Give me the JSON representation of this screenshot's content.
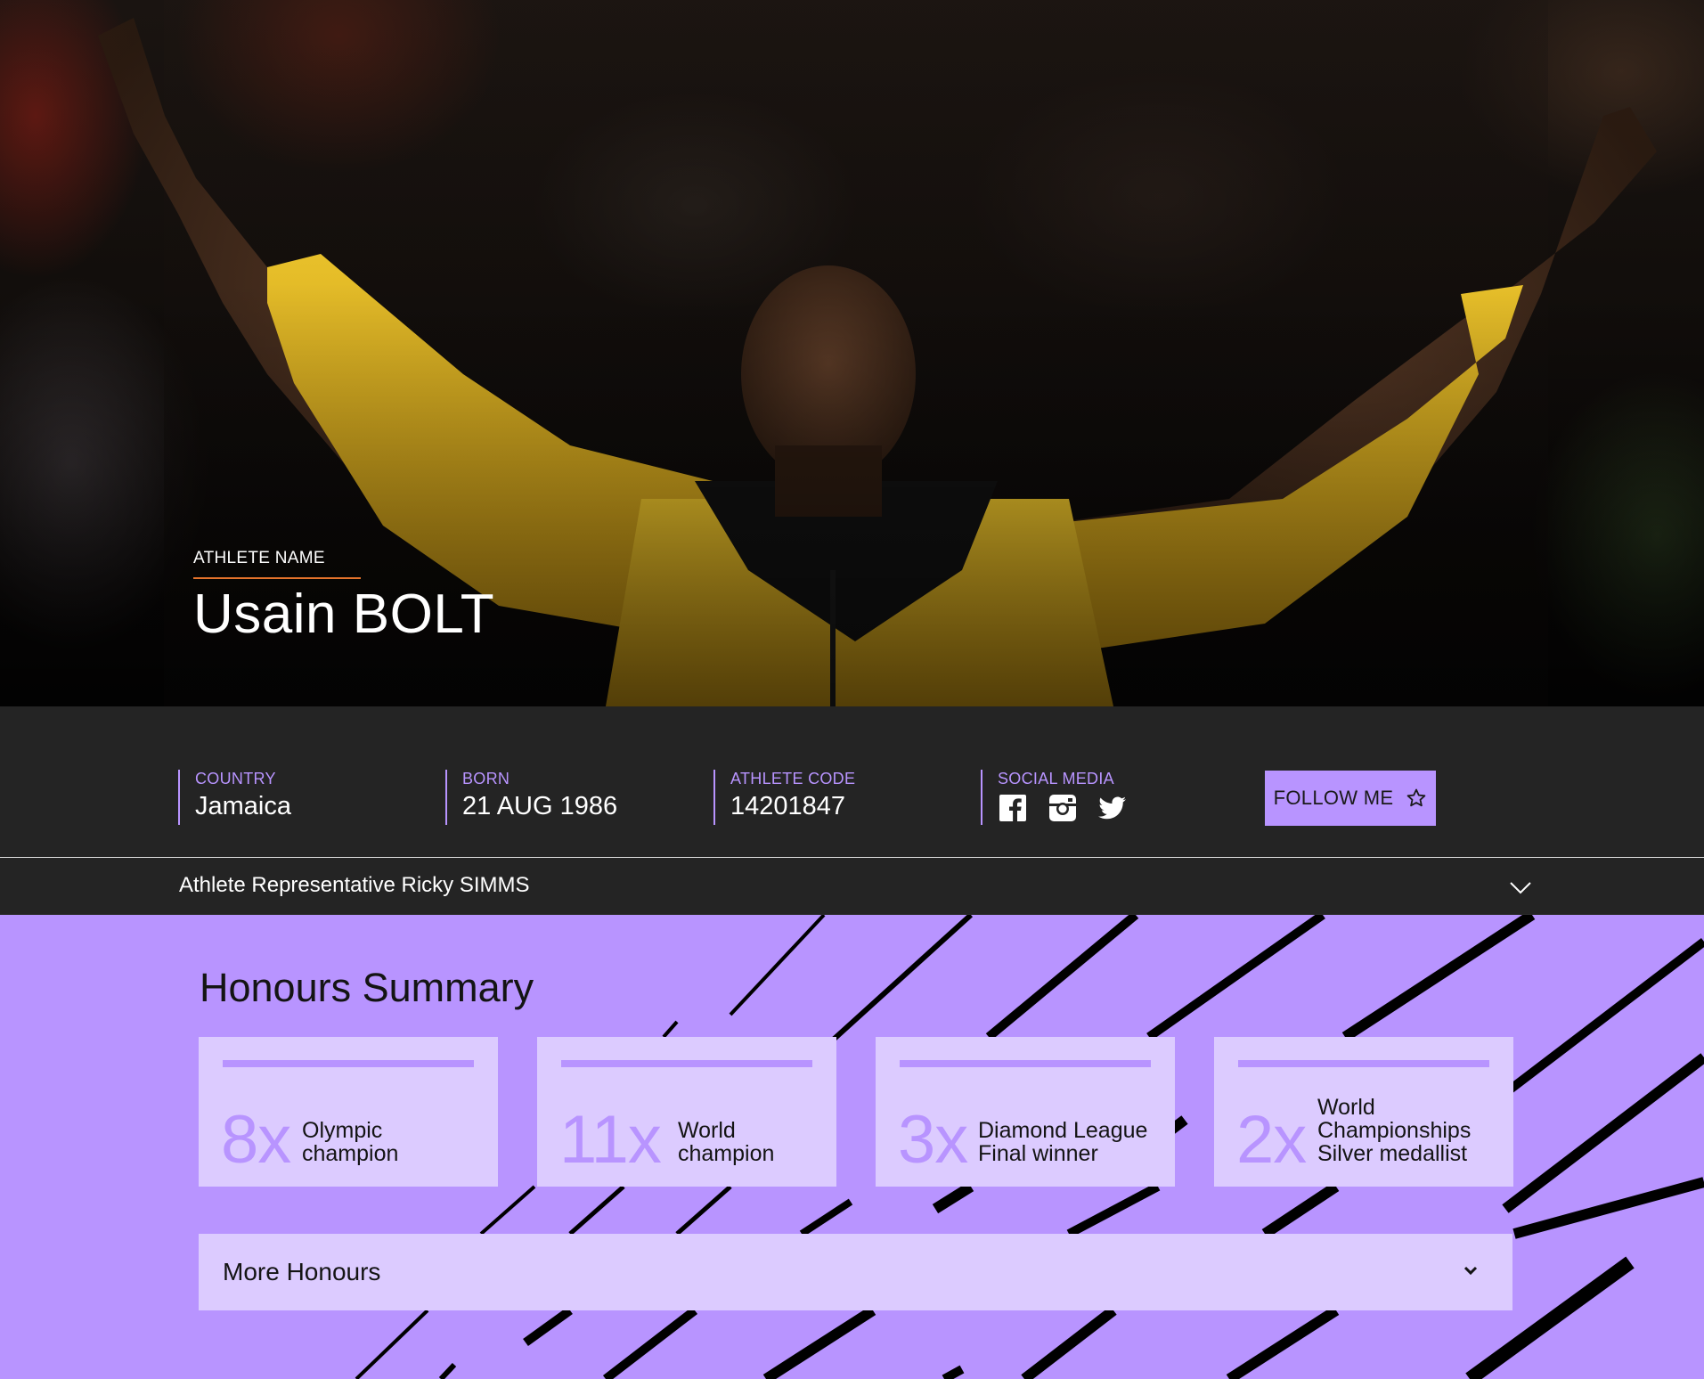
{
  "hero": {
    "label": "ATHLETE NAME",
    "name": "Usain BOLT"
  },
  "info": {
    "country_label": "COUNTRY",
    "country_value": "Jamaica",
    "born_label": "BORN",
    "born_value": "21 AUG 1986",
    "code_label": "ATHLETE CODE",
    "code_value": "14201847",
    "social_label": "SOCIAL MEDIA",
    "social_icons": [
      "facebook-icon",
      "instagram-icon",
      "twitter-icon"
    ],
    "follow_label": "FOLLOW ME"
  },
  "representative": {
    "text": "Athlete Representative Ricky SIMMS"
  },
  "honours": {
    "title": "Honours Summary",
    "cards": [
      {
        "count": "8x",
        "line1": "Olympic",
        "line2": "champion",
        "line3": ""
      },
      {
        "count": "11x",
        "line1": "World",
        "line2": "champion",
        "line3": ""
      },
      {
        "count": "3x",
        "line1": "Diamond League",
        "line2": "Final winner",
        "line3": ""
      },
      {
        "count": "2x",
        "line1": "World",
        "line2": "Championships",
        "line3": "Silver medallist"
      }
    ],
    "more_label": "More Honours"
  },
  "colors": {
    "accent_purple": "#b894ff",
    "card_light": "#dccbff",
    "dark_bar": "#242424",
    "orange_rule": "#e3722b"
  }
}
